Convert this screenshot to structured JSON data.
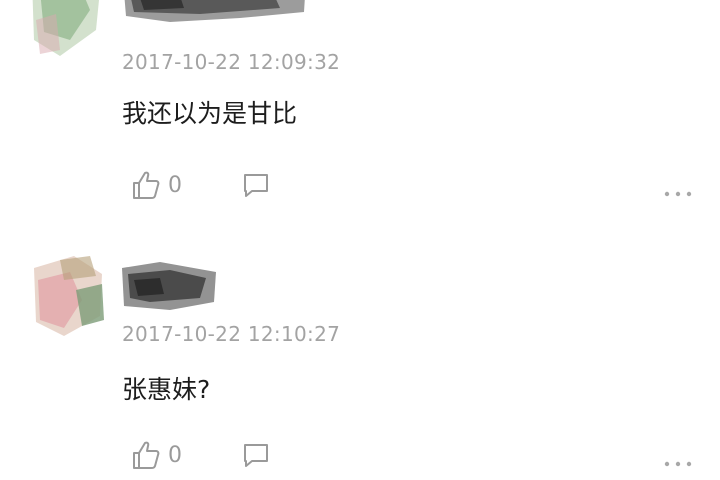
{
  "comments": [
    {
      "timestamp": "2017-10-22 12:09:32",
      "text": "我还以为是甘比",
      "like_count": "0",
      "avatar_icon": "avatar-icon",
      "like_icon": "thumbs-up-icon",
      "reply_icon": "comment-bubble-icon",
      "more_icon": "more-dots-icon"
    },
    {
      "timestamp": "2017-10-22 12:10:27",
      "text": "张惠妹?",
      "like_count": "0",
      "avatar_icon": "avatar-icon",
      "like_icon": "thumbs-up-icon",
      "reply_icon": "comment-bubble-icon",
      "more_icon": "more-dots-icon"
    }
  ]
}
